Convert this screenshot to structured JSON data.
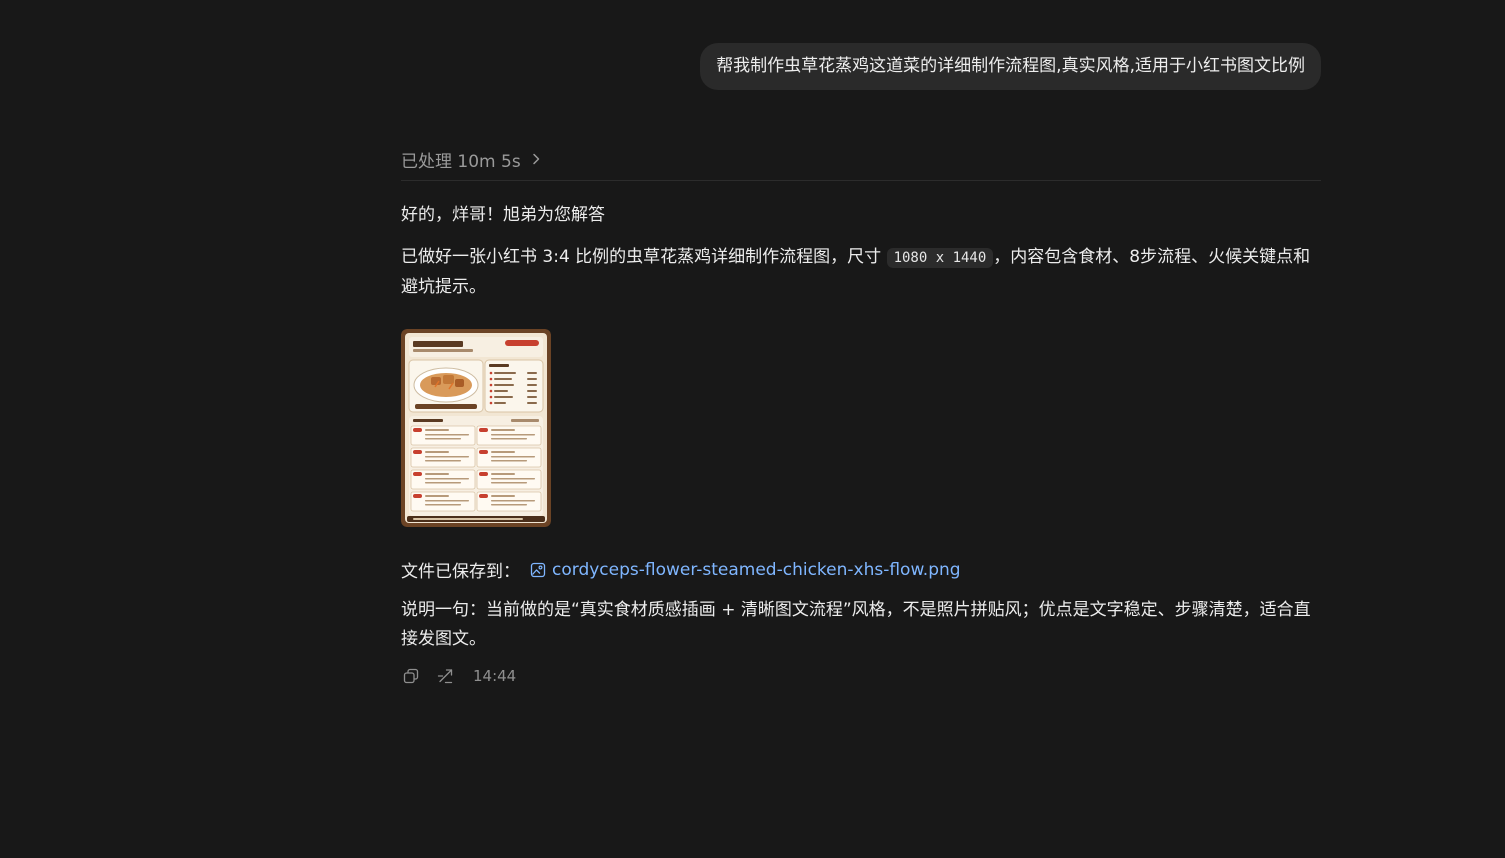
{
  "user_message": {
    "text": "帮我制作虫草花蒸鸡这道菜的详细制作流程图,真实风格,适用于小红书图文比例"
  },
  "assistant": {
    "processed_label": "已处理 10m 5s",
    "greeting": "好的，烊哥！旭弟为您解答",
    "summary_before_code": "已做好一张小红书 3:4 比例的虫草花蒸鸡详细制作流程图，尺寸 ",
    "summary_code": "1080 x 1440",
    "summary_after_code": "，内容包含食材、8步流程、火候关键点和避坑提示。",
    "saved_label": "文件已保存到：",
    "file_name": "cordyceps-flower-steamed-chicken-xhs-flow.png",
    "note": "说明一句：当前做的是“真实食材质感插画 + 清晰图文流程”风格，不是照片拼贴风；优点是文字稳定、步骤清楚，适合直接发图文。",
    "timestamp": "14:44"
  },
  "icons": {
    "processed_chevron": "chevron-right-icon",
    "file": "image-file-icon",
    "copy": "copy-icon",
    "share": "share-icon"
  },
  "colors": {
    "background": "#181818",
    "bubble": "#2a2a2a",
    "link": "#7fb6ff",
    "muted": "#9a9a9a"
  }
}
